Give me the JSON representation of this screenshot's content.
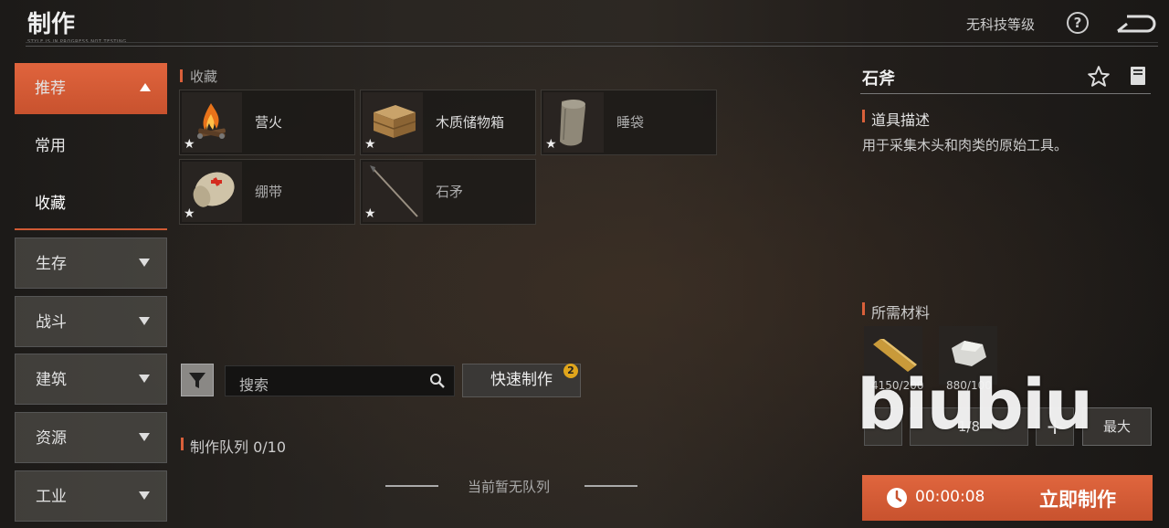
{
  "header": {
    "title": "制作",
    "subtitle": "STYLE IS IN PROGRESS  NOT TESTING",
    "tech_level": "无科技等级"
  },
  "sidebar": {
    "items": [
      {
        "label": "推荐",
        "state": "active-expanded"
      },
      {
        "label": "常用",
        "state": "plain"
      },
      {
        "label": "收藏",
        "state": "plain-selected"
      },
      {
        "label": "生存",
        "state": "collapsed"
      },
      {
        "label": "战斗",
        "state": "collapsed"
      },
      {
        "label": "建筑",
        "state": "collapsed"
      },
      {
        "label": "资源",
        "state": "collapsed"
      },
      {
        "label": "工业",
        "state": "collapsed"
      }
    ]
  },
  "favorites": {
    "title": "收藏",
    "items": [
      {
        "name": "营火",
        "icon": "campfire-icon",
        "starred": true
      },
      {
        "name": "木质储物箱",
        "icon": "wooden-box-icon",
        "starred": true
      },
      {
        "name": "睡袋",
        "icon": "sleeping-bag-icon",
        "starred": true
      },
      {
        "name": "绷带",
        "icon": "bandage-icon",
        "starred": true
      },
      {
        "name": "石矛",
        "icon": "stone-spear-icon",
        "starred": true
      }
    ]
  },
  "search": {
    "placeholder": "搜索"
  },
  "quick_craft": {
    "label": "快速制作",
    "badge": "2"
  },
  "queue": {
    "label": "制作队列 0/10",
    "empty_text": "当前暂无队列"
  },
  "detail": {
    "item_name": "石斧",
    "desc_title": "道具描述",
    "desc_text": "用于采集木头和肉类的原始工具。",
    "materials_title": "所需材料",
    "materials": [
      {
        "icon": "wood-icon",
        "count": "4150/200"
      },
      {
        "icon": "stone-icon",
        "count": "880/100"
      }
    ],
    "quantity": "1/8",
    "plus": "+",
    "max_label": "最大",
    "craft_time": "00:00:08",
    "craft_label": "立即制作"
  },
  "watermark": "biubiu",
  "colors": {
    "accent": "#d9603a",
    "badge": "#e0a51c"
  }
}
